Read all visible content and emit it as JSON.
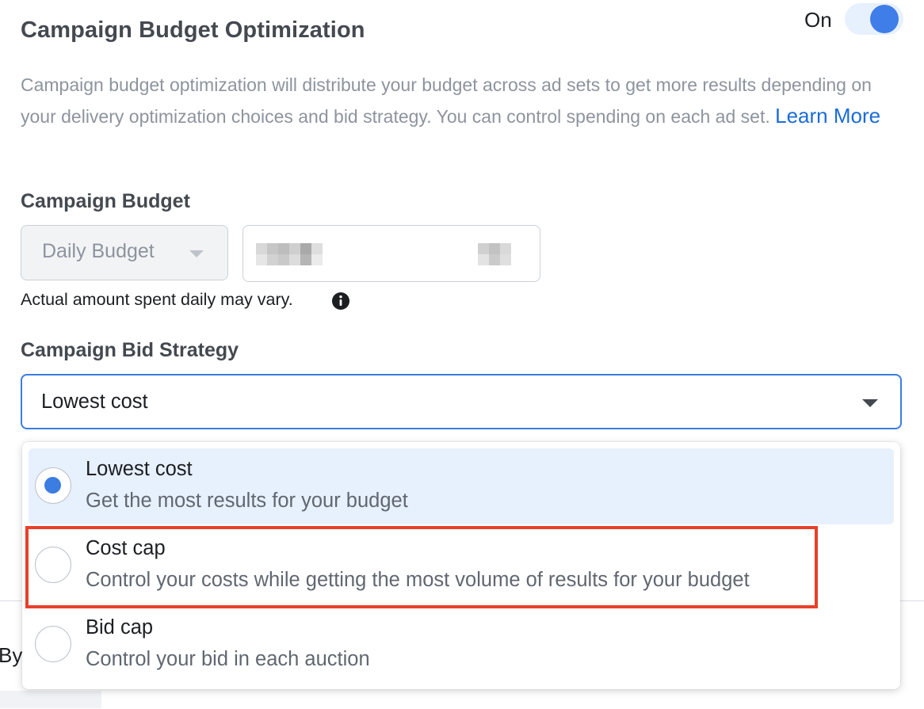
{
  "section": {
    "title": "Campaign Budget Optimization",
    "toggle_label": "On",
    "toggle_state": "on",
    "description": "Campaign budget optimization will distribute your budget across ad sets to get more results depending on your delivery optimization choices and bid strategy. You can control spending on each ad set.",
    "learn_more": "Learn More"
  },
  "budget": {
    "label": "Campaign Budget",
    "type_value": "Daily Budget",
    "note": "Actual amount spent daily may vary."
  },
  "bid_strategy": {
    "label": "Campaign Bid Strategy",
    "selected_value": "Lowest cost",
    "options": [
      {
        "title": "Lowest cost",
        "description": "Get the most results for your budget",
        "selected": true
      },
      {
        "title": "Cost cap",
        "description": "Control your costs while getting the most volume of results for your budget",
        "selected": false
      },
      {
        "title": "Bid cap",
        "description": "Control your bid in each auction",
        "selected": false
      }
    ]
  },
  "background": {
    "partial_text": "By"
  },
  "colors": {
    "accent": "#3b7de0",
    "link": "#1b6cd7",
    "highlight": "#e8402b",
    "selected_bg": "#e7f0fd"
  }
}
